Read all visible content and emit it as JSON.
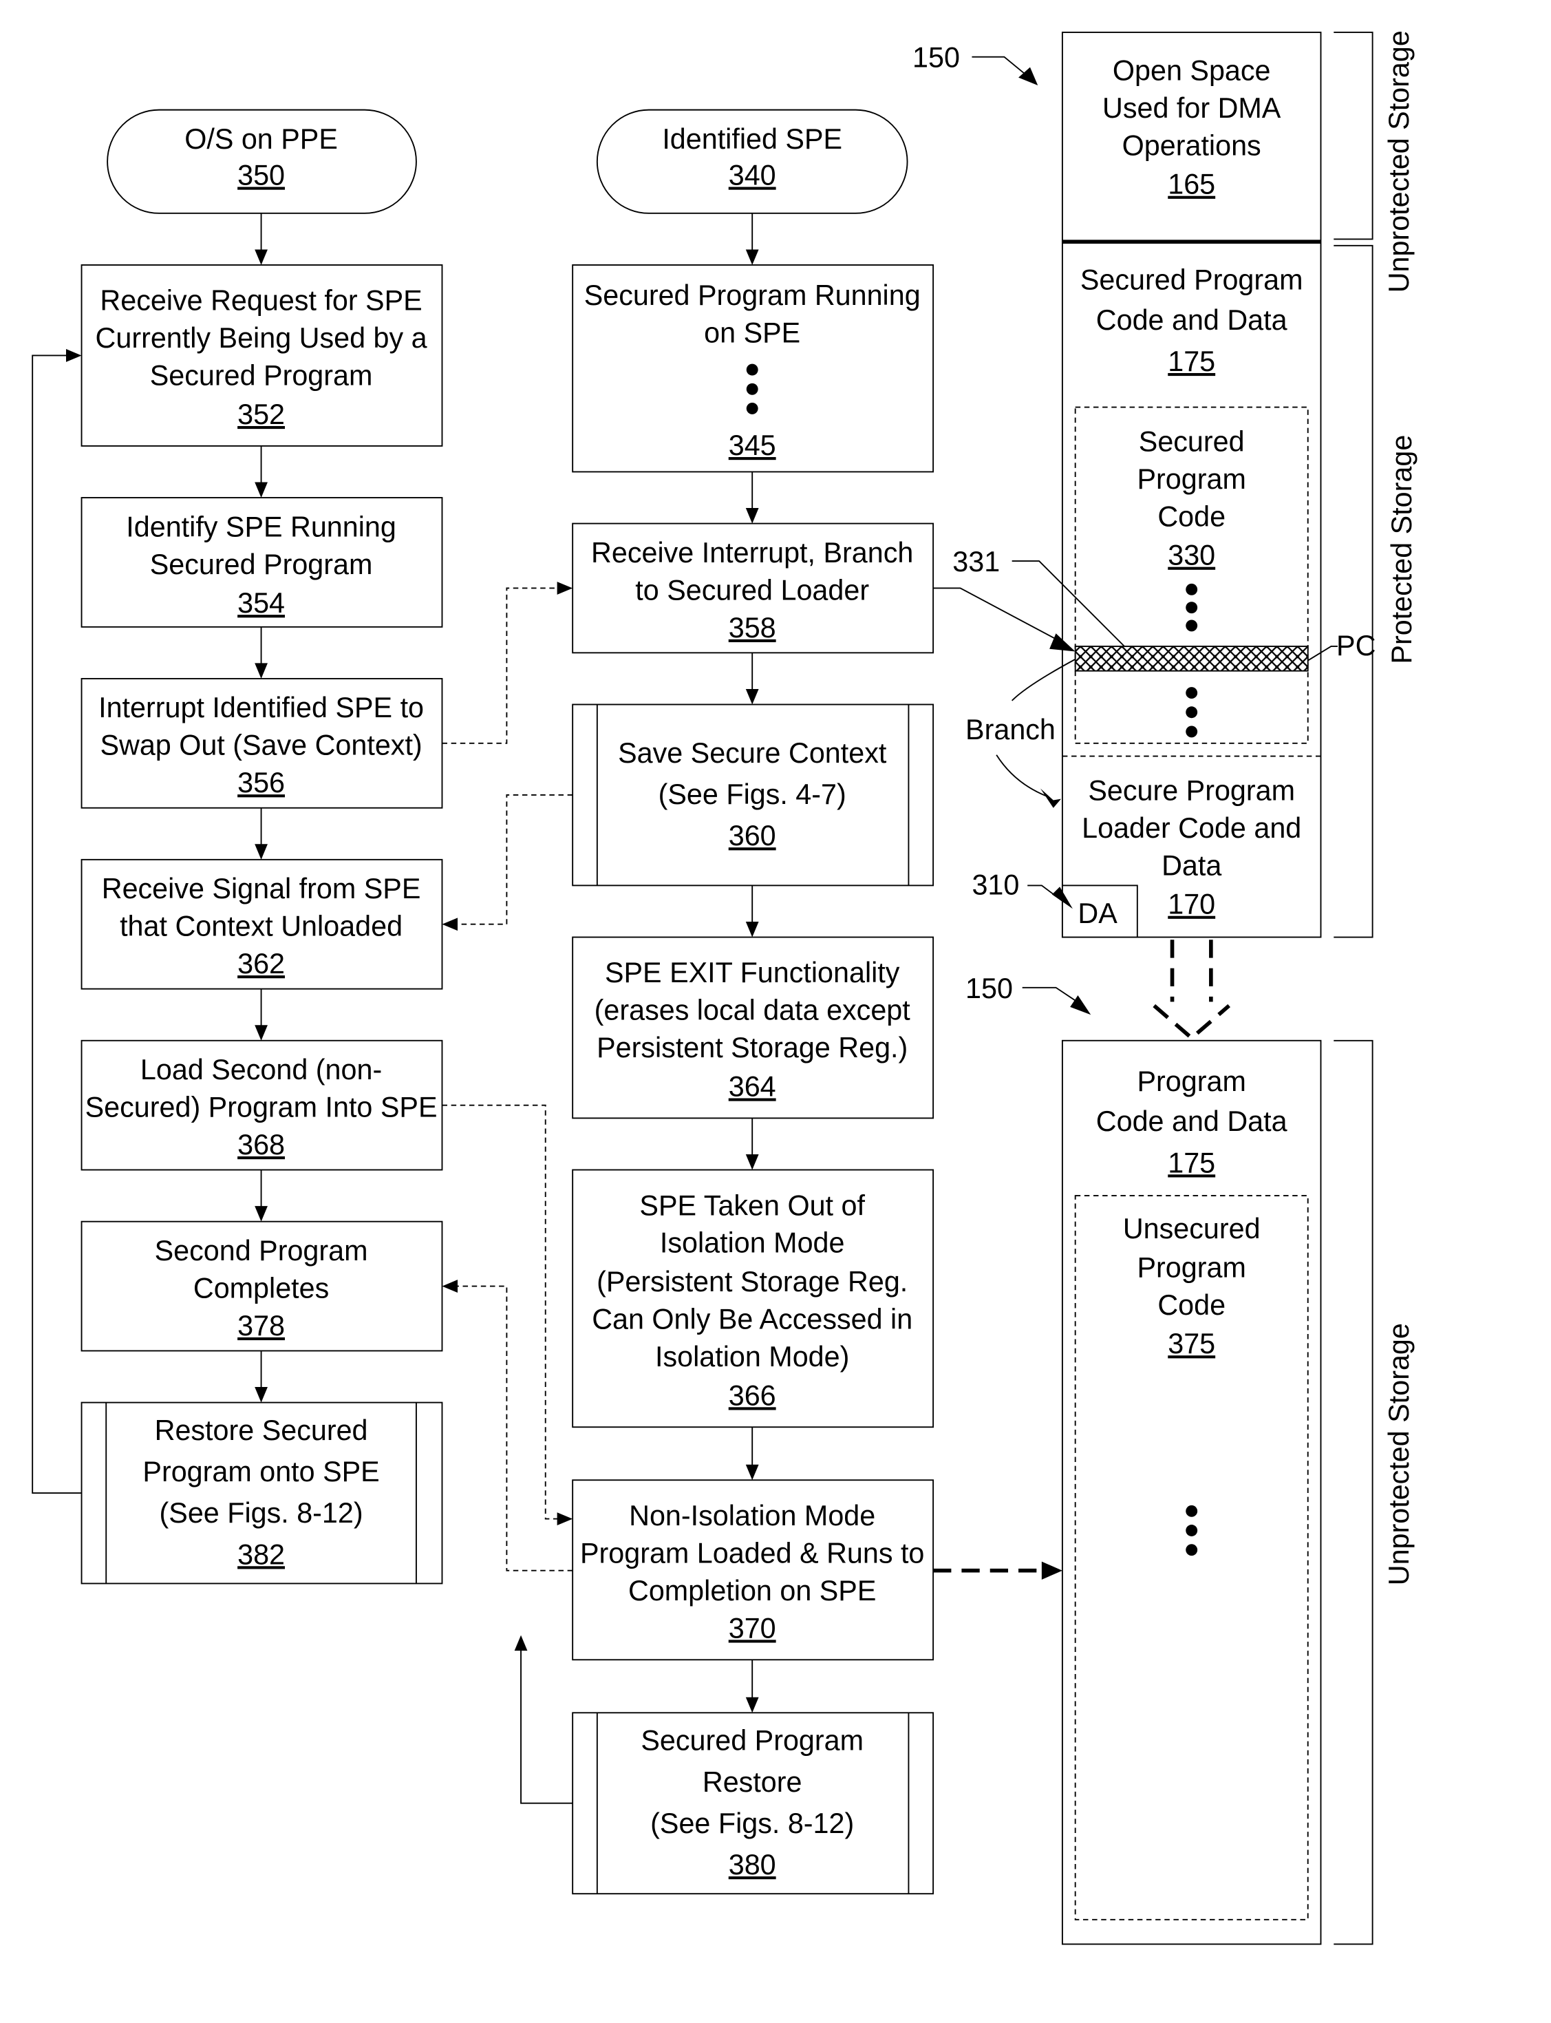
{
  "left_column": {
    "start": {
      "label": "O/S on PPE",
      "ref": "350"
    },
    "steps": [
      {
        "lines": [
          "Receive Request for SPE",
          "Currently Being Used by a",
          "Secured Program"
        ],
        "ref": "352"
      },
      {
        "lines": [
          "Identify SPE Running",
          "Secured Program"
        ],
        "ref": "354"
      },
      {
        "lines": [
          "Interrupt Identified SPE to",
          "Swap Out (Save Context)"
        ],
        "ref": "356"
      },
      {
        "lines": [
          "Receive Signal from SPE",
          "that Context Unloaded"
        ],
        "ref": "362"
      },
      {
        "lines": [
          "Load Second (non-",
          "Secured) Program Into SPE"
        ],
        "ref": "368"
      },
      {
        "lines": [
          "Second Program",
          "Completes"
        ],
        "ref": "378"
      },
      {
        "lines": [
          "Restore Secured",
          "Program onto SPE",
          "(See Figs. 8-12)"
        ],
        "ref": "382"
      }
    ]
  },
  "middle_column": {
    "start": {
      "label": "Identified SPE",
      "ref": "340"
    },
    "steps": [
      {
        "lines": [
          "Secured Program Running",
          "on SPE"
        ],
        "ref": "345"
      },
      {
        "lines": [
          "Receive Interrupt, Branch",
          "to Secured Loader"
        ],
        "ref": "358"
      },
      {
        "lines": [
          "Save Secure Context",
          "(See Figs.  4-7)"
        ],
        "ref": "360"
      },
      {
        "lines": [
          "SPE EXIT Functionality",
          "(erases local data except",
          "Persistent Storage Reg.)"
        ],
        "ref": "364"
      },
      {
        "lines": [
          "SPE Taken Out of",
          "Isolation Mode",
          "(Persistent Storage Reg.",
          "Can Only Be Accessed in",
          "Isolation Mode)"
        ],
        "ref": "366"
      },
      {
        "lines": [
          "Non-Isolation Mode",
          "Program Loaded & Runs to",
          "Completion on SPE"
        ],
        "ref": "370"
      },
      {
        "lines": [
          "Secured Program",
          "Restore",
          "(See Figs. 8-12)"
        ],
        "ref": "380"
      }
    ]
  },
  "storage_top": {
    "ref_label": "150",
    "open_space": {
      "lines": [
        "Open Space",
        "Used for DMA",
        "Operations"
      ],
      "ref": "165"
    },
    "secured_data": {
      "lines": [
        "Secured Program",
        "Code and Data"
      ],
      "ref": "175"
    },
    "secured_code": {
      "lines": [
        "Secured",
        "Program",
        "Code"
      ],
      "ref": "330"
    },
    "loader": {
      "lines": [
        "Secure Program",
        "Loader Code and",
        "Data"
      ],
      "ref": "170"
    },
    "da_label": "DA",
    "da_ref": "310",
    "pc_label": "PC",
    "pc_ref": "331",
    "branch_label": "Branch",
    "bracket_unprotected": "Unprotected Storage",
    "bracket_protected": "Protected Storage"
  },
  "storage_bottom": {
    "ref_label": "150",
    "program_data": {
      "lines": [
        "Program",
        "Code and Data"
      ],
      "ref": "175"
    },
    "unsecured_code": {
      "lines": [
        "Unsecured",
        "Program",
        "Code"
      ],
      "ref": "375"
    },
    "bracket_unprotected": "Unprotected Storage"
  }
}
